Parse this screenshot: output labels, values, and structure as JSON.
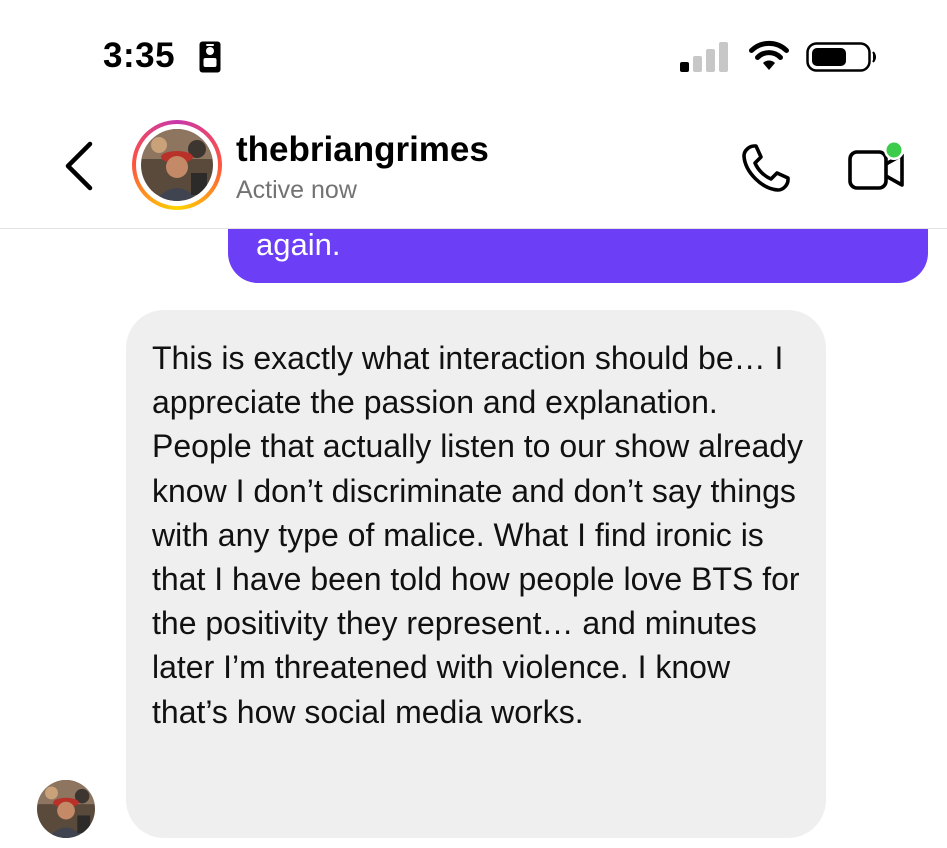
{
  "status_bar": {
    "time": "3:35",
    "icons": [
      "id-badge-icon",
      "signal-icon",
      "wifi-icon",
      "battery-icon"
    ]
  },
  "header": {
    "username": "thebriangrimes",
    "status": "Active now",
    "icons": [
      "back-chevron-icon",
      "phone-icon",
      "video-camera-icon"
    ],
    "online_dot_color": "#3ccb4b",
    "story_ring_colors": [
      "#c837ab",
      "#ff543e",
      "#fdd500"
    ]
  },
  "messages": [
    {
      "direction": "outgoing",
      "text": "again.",
      "bubble_color": "#6c3ef5"
    },
    {
      "direction": "incoming",
      "text": "This is exactly what interaction should be… I appreciate the passion and explanation. People that actually listen to our show already know I don’t discriminate and don’t say things with any type of malice. What I find ironic is that I have been told how people love BTS for the positivity they represent… and minutes later I’m threatened with violence. I know that’s how social media works.",
      "bubble_color": "#efefef"
    }
  ]
}
